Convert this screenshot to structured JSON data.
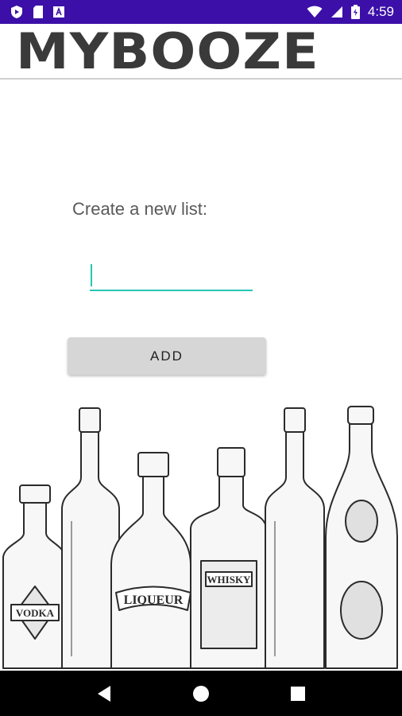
{
  "status_bar": {
    "time": "4:59",
    "background": "#3c0fa8",
    "left_icons": [
      "play-protect-icon",
      "sd-card-icon",
      "app-notification-icon"
    ],
    "right_icons": [
      "wifi-icon",
      "signal-icon",
      "battery-icon"
    ]
  },
  "app_bar": {
    "title": "MYBOOZE"
  },
  "form": {
    "prompt": "Create a new list:",
    "input_value": "",
    "input_placeholder": "",
    "accent_color": "#26c6b3",
    "add_label": "ADD"
  },
  "illustration": {
    "labels": {
      "vodka": "VODKA",
      "liqueur": "LIQUEUR",
      "whisky": "WHISKY"
    }
  },
  "nav_bar": {
    "buttons": [
      "back-icon",
      "home-icon",
      "recents-icon"
    ]
  }
}
